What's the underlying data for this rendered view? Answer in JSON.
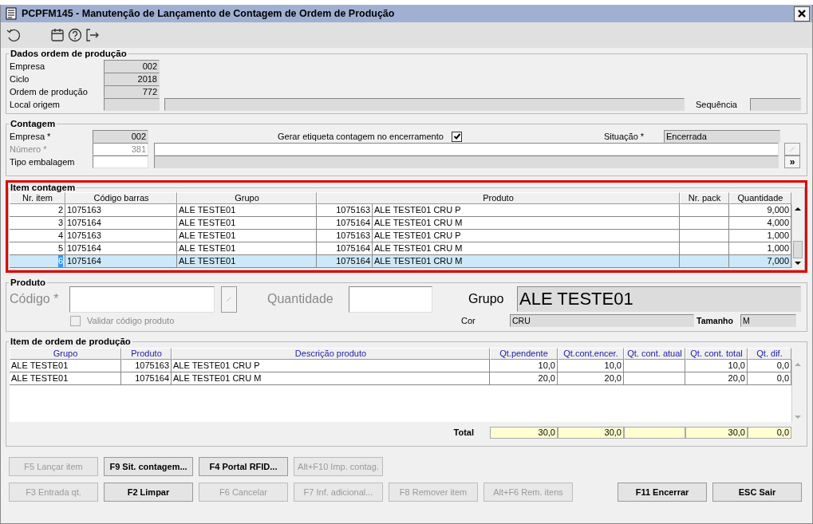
{
  "window": {
    "title": "PCPFM145 - Manutenção de Lançamento de Contagem de Ordem de Produção"
  },
  "dados_ordem": {
    "title": "Dados ordem de produção",
    "fields": [
      {
        "label": "Empresa",
        "value": "002"
      },
      {
        "label": "Ciclo",
        "value": "2018"
      },
      {
        "label": "Ordem de produção",
        "value": "772"
      }
    ],
    "local_label": "Local origem",
    "sequencia_label": "Sequência"
  },
  "contagem": {
    "title": "Contagem",
    "empresa_label": "Empresa *",
    "empresa": "002",
    "numero_label": "Número *",
    "numero": "381",
    "numero_disabled": true,
    "tipo_label": "Tipo embalagem",
    "gerar_label": "Gerar etiqueta contagem no encerramento",
    "gerar_checked": true,
    "situacao_label": "Situação *",
    "situacao": "Encerrada",
    "next_button": "»"
  },
  "item_contagem": {
    "title": "Item contagem",
    "highlighted": true,
    "columns": [
      "Nr. item",
      "Código barras",
      "Grupo",
      "Produto",
      "Nr. pack",
      "Quantidade"
    ],
    "rows": [
      {
        "nr": "2",
        "barcode": "1075163",
        "group": "ALE TESTE01",
        "product_code": "1075163",
        "product_name": "ALE TESTE01 CRU P",
        "qty": "9,000",
        "selected": false
      },
      {
        "nr": "3",
        "barcode": "1075164",
        "group": "ALE TESTE01",
        "product_code": "1075164",
        "product_name": "ALE TESTE01 CRU M",
        "qty": "4,000",
        "selected": false
      },
      {
        "nr": "4",
        "barcode": "1075163",
        "group": "ALE TESTE01",
        "product_code": "1075163",
        "product_name": "ALE TESTE01 CRU P",
        "qty": "1,000",
        "selected": false
      },
      {
        "nr": "5",
        "barcode": "1075164",
        "group": "ALE TESTE01",
        "product_code": "1075164",
        "product_name": "ALE TESTE01 CRU M",
        "qty": "1,000",
        "selected": false
      },
      {
        "nr": "6",
        "barcode": "1075164",
        "group": "ALE TESTE01",
        "product_code": "1075164",
        "product_name": "ALE TESTE01 CRU M",
        "qty": "7,000",
        "selected": true
      }
    ]
  },
  "produto": {
    "title": "Produto",
    "codigo_label": "Código *",
    "quantidade_label": "Quantidade",
    "validar_label": "Validar código produto",
    "validar_checked": false,
    "validar_disabled": true,
    "grupo_label": "Grupo",
    "grupo": "ALE TESTE01",
    "cor_label": "Cor",
    "cor": "CRU",
    "tamanho_label": "Tamanho",
    "tamanho": "M"
  },
  "item_ordem": {
    "title": "Item de ordem de produção",
    "columns": [
      "Grupo",
      "Produto",
      "Descrição produto",
      "Qt.pendente",
      "Qt.cont.encer.",
      "Qt. cont. atual",
      "Qt. cont. total",
      "Qt. dif."
    ],
    "rows": [
      {
        "group": "ALE TESTE01",
        "product": "1075163",
        "description": "ALE TESTE01 CRU P",
        "pendente": "10,0",
        "encerrada": "10,0",
        "total": "10,0",
        "dif": "0,0"
      },
      {
        "group": "ALE TESTE01",
        "product": "1075164",
        "description": "ALE TESTE01 CRU M",
        "pendente": "20,0",
        "encerrada": "20,0",
        "total": "20,0",
        "dif": "0,0"
      }
    ],
    "total_label": "Total",
    "totals": {
      "pendente": "30,0",
      "encerrada": "30,0",
      "total": "30,0",
      "dif": "0,0"
    }
  },
  "button_rows": [
    [
      {
        "label": "F5 Lançar item",
        "disabled": true
      },
      {
        "label": "F9 Sit. contagem...",
        "disabled": false
      },
      {
        "label": "F4 Portal RFID...",
        "disabled": false
      },
      {
        "label": "Alt+F10 Imp. contag.",
        "disabled": true
      }
    ],
    [
      {
        "label": "F3 Entrada qt.",
        "disabled": true
      },
      {
        "label": "F2 Limpar",
        "disabled": false
      },
      {
        "label": "F6 Cancelar",
        "disabled": true
      },
      {
        "label": "F7 Inf. adicional...",
        "disabled": true
      },
      {
        "label": "F8 Remover item",
        "disabled": true
      },
      {
        "label": "Alt+F6 Rem. itens",
        "disabled": true
      }
    ]
  ],
  "dialog_buttons": [
    {
      "label": "F11 Encerrar",
      "disabled": false
    },
    {
      "label": "ESC Sair",
      "disabled": false
    }
  ]
}
